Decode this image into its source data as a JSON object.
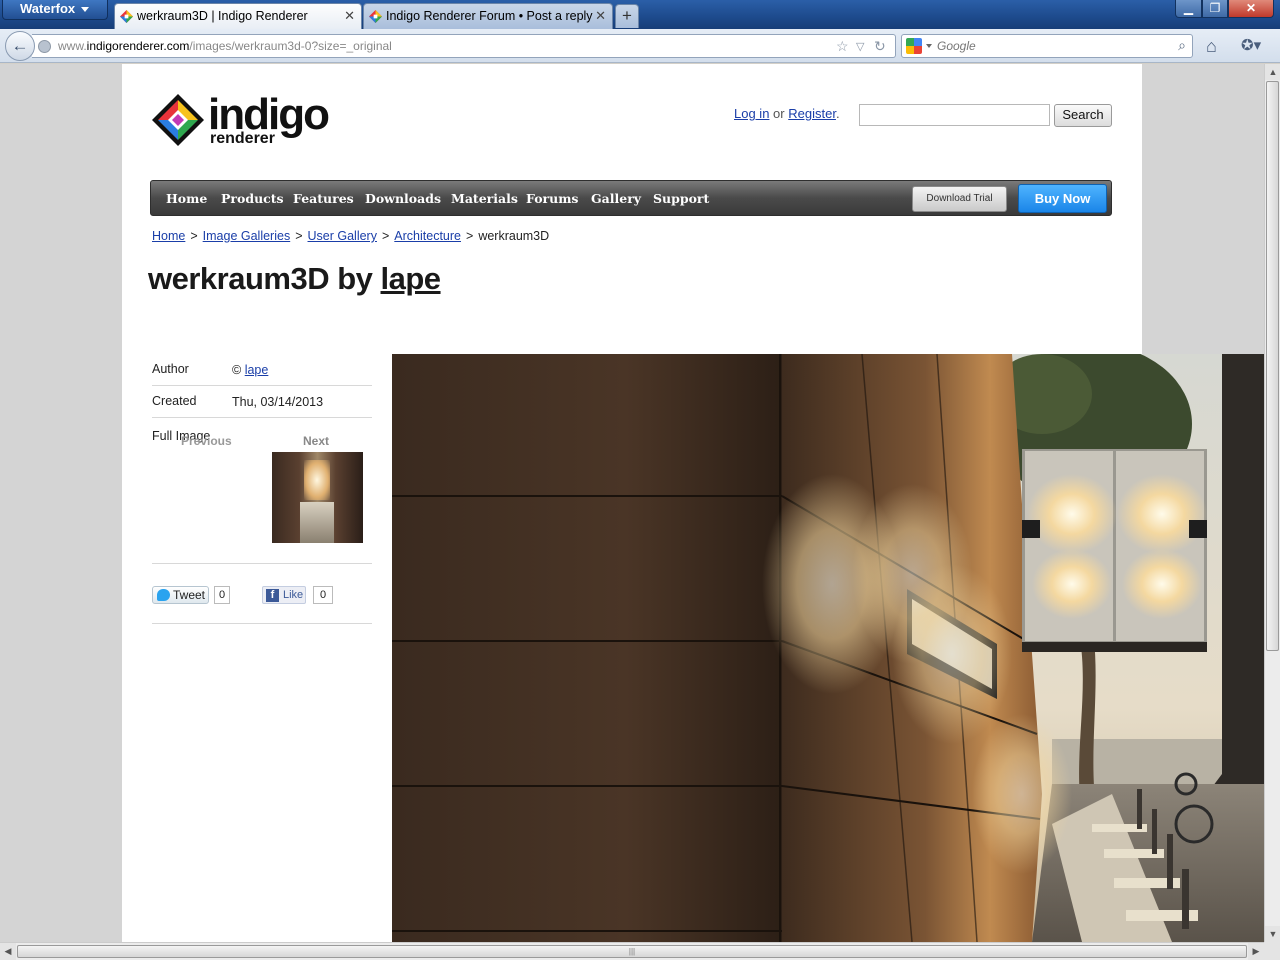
{
  "browser": {
    "app_name": "Waterfox",
    "tabs": [
      {
        "title": "werkraum3D | Indigo Renderer",
        "active": true
      },
      {
        "title": "Indigo Renderer Forum • Post a reply",
        "active": false
      }
    ],
    "new_tab_label": "+",
    "url_prefix": "www.",
    "url_domain": "indigorenderer.com",
    "url_path": "/images/werkraum3d-0?size=_original",
    "search_placeholder": "Google"
  },
  "header": {
    "logo_word": "indigo",
    "logo_sub": "renderer",
    "login_label": "Log in",
    "or_label": "or",
    "register_label": "Register",
    "period": ".",
    "search_button": "Search"
  },
  "nav": {
    "items": [
      "Home",
      "Products",
      "Features",
      "Downloads",
      "Materials",
      "Forums",
      "Gallery",
      "Support"
    ],
    "download_trial": "Download Trial",
    "buy_now": "Buy Now"
  },
  "breadcrumb": {
    "links": [
      "Home",
      "Image Galleries",
      "User Gallery",
      "Architecture"
    ],
    "separator": ">",
    "current": "werkraum3D"
  },
  "title": {
    "prefix": "werkraum3D by",
    "author": "lape"
  },
  "info": {
    "author_label": "Author",
    "copyright_symbol": "©",
    "author_value": "lape",
    "created_label": "Created",
    "created_value": "Thu, 03/14/2013",
    "full_image_label": "Full Image",
    "previous_label": "Previous",
    "next_label": "Next"
  },
  "social": {
    "tweet_label": "Tweet",
    "tweet_count": "0",
    "like_label": "Like",
    "like_count": "0"
  },
  "colors": {
    "link": "#1a3ea8",
    "nav_bg": "#4a4a4a",
    "buy_now": "#1a85e8"
  }
}
